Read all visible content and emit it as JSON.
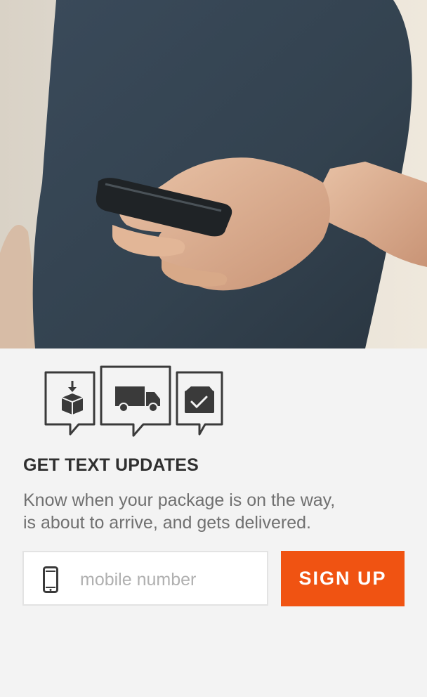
{
  "hero": {
    "image": "man-holding-smartphone-photo"
  },
  "icons": [
    "package-arrival-icon",
    "delivery-truck-icon",
    "delivered-checkmark-icon"
  ],
  "signup_section": {
    "title": "GET TEXT UPDATES",
    "description_lines": [
      "Know when your package is on the way,",
      "is about to arrive, and gets delivered."
    ],
    "phone_input": {
      "placeholder": "mobile number",
      "value": ""
    },
    "signup_button": "SIGN UP"
  },
  "colors": {
    "accent": "#f05312",
    "background": "#f3f3f3",
    "title": "#2f2f2f",
    "body": "#707070"
  }
}
